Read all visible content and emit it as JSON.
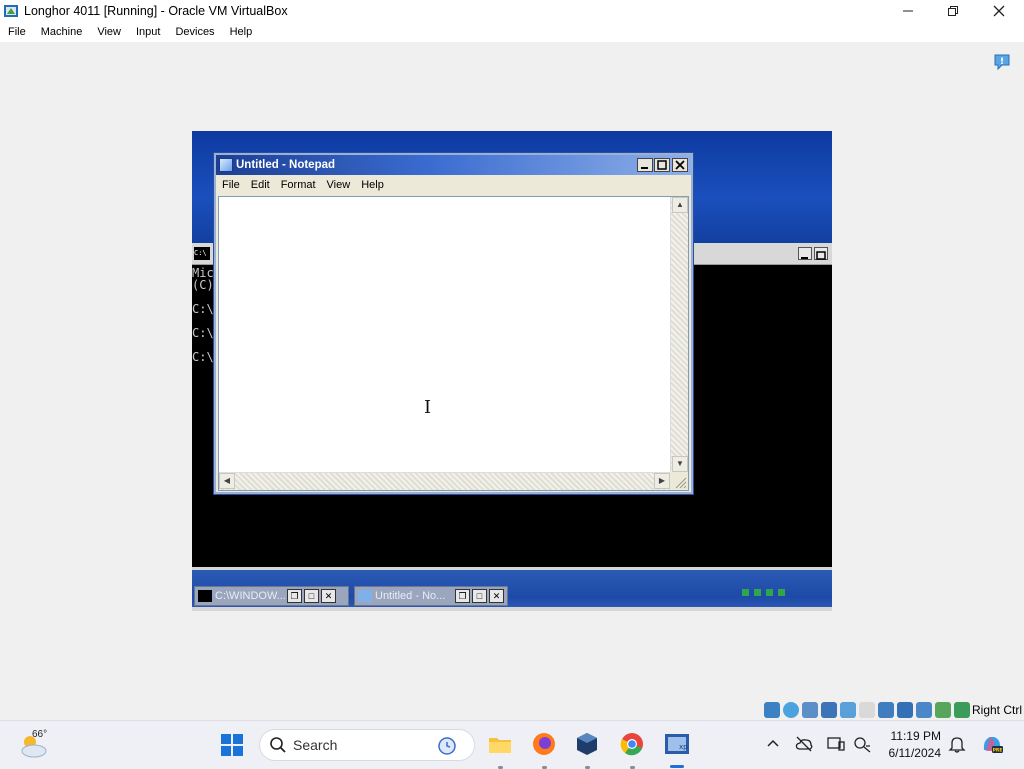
{
  "host": {
    "title": "Longhor 4011 [Running] - Oracle VM VirtualBox",
    "menu": [
      "File",
      "Machine",
      "View",
      "Input",
      "Devices",
      "Help"
    ],
    "host_key": "Right Ctrl"
  },
  "guest": {
    "notepad": {
      "title": "Untitled - Notepad",
      "menu": [
        "File",
        "Edit",
        "Format",
        "View",
        "Help"
      ],
      "content": ""
    },
    "console": {
      "lines": [
        "Mic",
        "(C)",
        "",
        "C:\\",
        "",
        "C:\\",
        "",
        "C:\\"
      ]
    },
    "taskbar": {
      "buttons": [
        {
          "label": "C:\\WINDOW..."
        },
        {
          "label": "Untitled - No..."
        }
      ]
    }
  },
  "taskbar": {
    "weather_temp": "66°",
    "search_label": "Search",
    "time": "11:19 PM",
    "date": "6/11/2024"
  }
}
